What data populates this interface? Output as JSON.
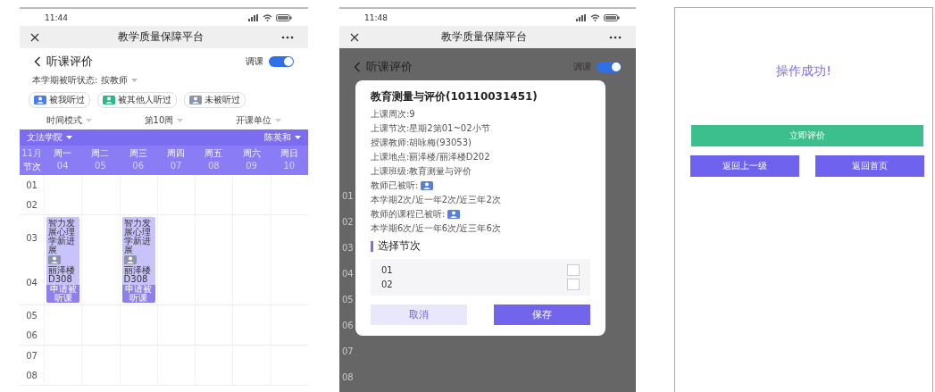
{
  "schedule_screen": {
    "status_bar": {
      "time": "11:44"
    },
    "title": "教学质量保障平台",
    "back_title": "听课评价",
    "toggle": {
      "label": "调课",
      "on": true
    },
    "status_label": "本学期被听状态:",
    "status_value": "按教师",
    "legend": [
      {
        "label": "被我听过",
        "color": "#4a7cf0"
      },
      {
        "label": "被其他人听过",
        "color": "#2fb58a"
      },
      {
        "label": "未被听过",
        "color": "#8a95a8"
      }
    ],
    "filters": [
      "时间模式",
      "第10周",
      "开课单位"
    ],
    "college": "文法学院",
    "teacher": "陈英和",
    "month": "11月",
    "period_heading": "节次",
    "days": [
      {
        "day": "周一",
        "date": "04"
      },
      {
        "day": "周二",
        "date": "05"
      },
      {
        "day": "周三",
        "date": "06"
      },
      {
        "day": "周四",
        "date": "07"
      },
      {
        "day": "周五",
        "date": "08"
      },
      {
        "day": "周六",
        "date": "09"
      },
      {
        "day": "周日",
        "date": "10"
      }
    ],
    "period_groups": [
      {
        "periods": [
          "01",
          "02"
        ],
        "cells": [
          {
            "kind": "empty"
          },
          {
            "kind": "empty"
          },
          {
            "kind": "empty"
          },
          {
            "kind": "empty"
          },
          {
            "kind": "empty"
          },
          {
            "kind": "empty"
          },
          {
            "kind": "empty"
          }
        ]
      },
      {
        "periods": [
          "03",
          "04"
        ],
        "cells": [
          {
            "kind": "course",
            "name": "智力发展心理学新进展",
            "room": "丽泽楼D308",
            "action": "申请被听课"
          },
          {
            "kind": "empty"
          },
          {
            "kind": "course",
            "name": "智力发展心理学新进展",
            "room": "丽泽楼D308",
            "action": "申请被听课"
          },
          {
            "kind": "empty"
          },
          {
            "kind": "empty"
          },
          {
            "kind": "empty"
          },
          {
            "kind": "empty"
          }
        ]
      },
      {
        "periods": [
          "05",
          "06"
        ],
        "cells": [
          {
            "kind": "empty"
          },
          {
            "kind": "empty"
          },
          {
            "kind": "empty"
          },
          {
            "kind": "empty"
          },
          {
            "kind": "empty"
          },
          {
            "kind": "empty"
          },
          {
            "kind": "empty"
          }
        ]
      },
      {
        "periods": [
          "07",
          "08"
        ],
        "cells": [
          {
            "kind": "empty"
          },
          {
            "kind": "empty"
          },
          {
            "kind": "empty"
          },
          {
            "kind": "empty"
          },
          {
            "kind": "empty"
          },
          {
            "kind": "empty"
          },
          {
            "kind": "empty"
          }
        ]
      }
    ]
  },
  "dialog_screen": {
    "status_bar": {
      "time": "11:48"
    },
    "title": "教学质量保障平台",
    "background": {
      "back_title": "听课评价",
      "toggle": {
        "label": "调课",
        "on": true
      },
      "period_labels": [
        "01",
        "02",
        "03",
        "04",
        "05",
        "06",
        "07",
        "08"
      ]
    },
    "dialog": {
      "course_title": "教育测量与评价(10110031451)",
      "details": [
        "上课周次:9",
        "上课节次:星期2第01~02小节",
        "授课教师:胡咏梅(93053)",
        "上课地点:丽泽楼/丽泽楼D202",
        "上课班级:教育测量与评价"
      ],
      "teacher_heard": {
        "label": "教师已被听:",
        "counts": "本学期2次/近一年2次/近三年2次"
      },
      "course_heard": {
        "label": "教师的课程已被听:",
        "counts": "本学期6次/近一年6次/近三年6次"
      },
      "section_title": "选择节次",
      "options": [
        {
          "label": "01",
          "checked": false
        },
        {
          "label": "02",
          "checked": false
        }
      ],
      "cancel": "取消",
      "save": "保存"
    }
  },
  "success_screen": {
    "message": "操作成功!",
    "primary_button": "立即评价",
    "buttons": [
      "返回上一级",
      "返回首页"
    ]
  }
}
